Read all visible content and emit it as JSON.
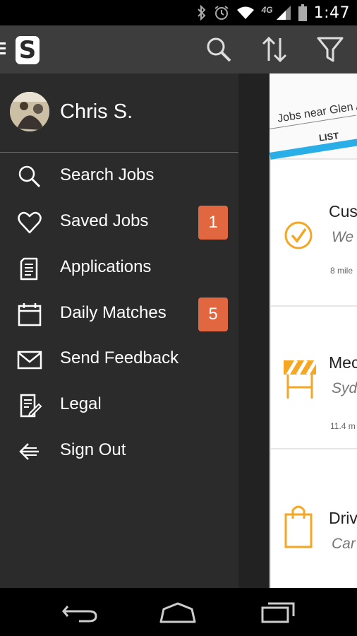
{
  "status_bar": {
    "time": "1:47",
    "network_label": "4G",
    "icons": [
      "bluetooth-icon",
      "alarm-icon",
      "wifi-icon",
      "signal-icon",
      "battery-icon"
    ]
  },
  "action_bar": {
    "logo_letter": "S",
    "icons": [
      "menu-icon",
      "search-icon",
      "sort-icon",
      "filter-icon"
    ]
  },
  "drawer": {
    "user_name": "Chris S.",
    "items": [
      {
        "label": "Search Jobs",
        "icon": "search-icon"
      },
      {
        "label": "Saved Jobs",
        "icon": "heart-icon",
        "badge": "1"
      },
      {
        "label": "Applications",
        "icon": "document-icon"
      },
      {
        "label": "Daily Matches",
        "icon": "calendar-icon",
        "badge": "5"
      },
      {
        "label": "Send Feedback",
        "icon": "envelope-icon"
      },
      {
        "label": "Legal",
        "icon": "legal-document-icon"
      },
      {
        "label": "Sign Out",
        "icon": "arrow-left-icon"
      }
    ]
  },
  "content": {
    "location": "Jobs near Glen A",
    "tab": "LIST",
    "cards": [
      {
        "title": "Custo",
        "subtitle": "We Tr",
        "distance": "8 mile",
        "icon": "checkmark-circle-icon"
      },
      {
        "title": "Mech",
        "subtitle": "Sydn",
        "distance": "11.4 m",
        "icon": "construction-barrier-icon"
      },
      {
        "title": "Drive",
        "subtitle": "Car p",
        "icon": "shopping-bag-icon"
      }
    ]
  },
  "colors": {
    "accent_orange": "#f5a623",
    "badge": "#e0673f",
    "tab_accent": "#29aee8"
  }
}
